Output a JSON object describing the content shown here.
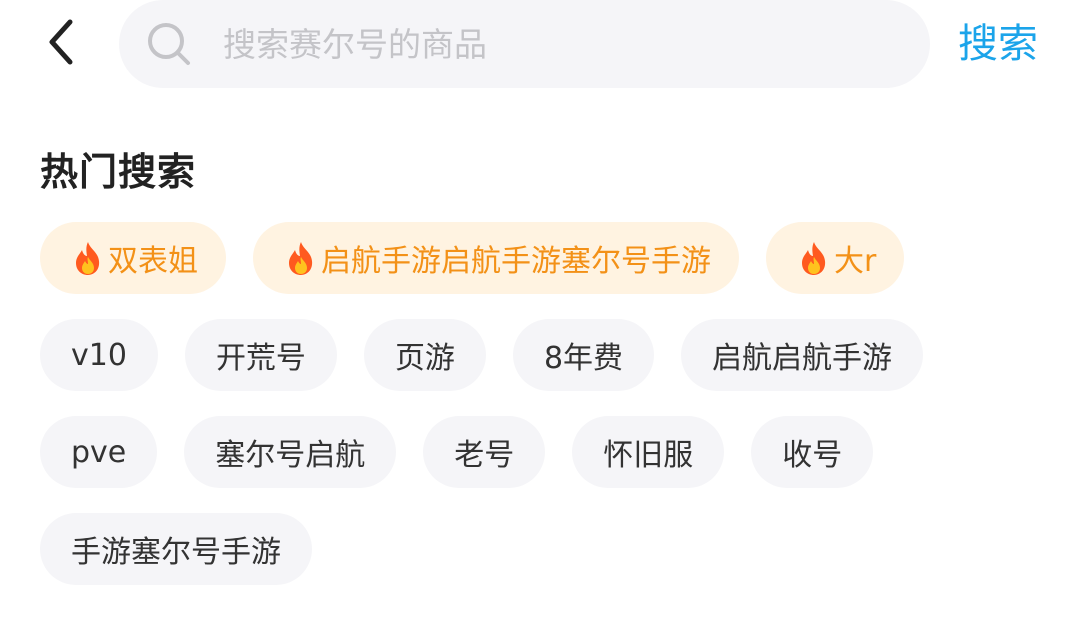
{
  "header": {
    "back_icon": "chevron-left-icon",
    "search_icon": "search-icon",
    "search_placeholder": "搜索赛尔号的商品",
    "search_value": "",
    "search_button": "搜索",
    "accent_color": "#1ba4ea"
  },
  "hot_search": {
    "title": "热门搜索",
    "hot_tags": [
      {
        "label": "双表姐",
        "icon": "fire-icon"
      },
      {
        "label": "启航手游启航手游塞尔号手游",
        "icon": "fire-icon"
      },
      {
        "label": "大r",
        "icon": "fire-icon"
      }
    ],
    "hot_color": "#f39117",
    "row2": [
      "v10",
      "开荒号",
      "页游",
      "8年费",
      "启航启航手游"
    ],
    "row3": [
      "pve",
      "塞尔号启航",
      "老号",
      "怀旧服",
      "收号"
    ],
    "row4": [
      "手游塞尔号手游"
    ]
  }
}
